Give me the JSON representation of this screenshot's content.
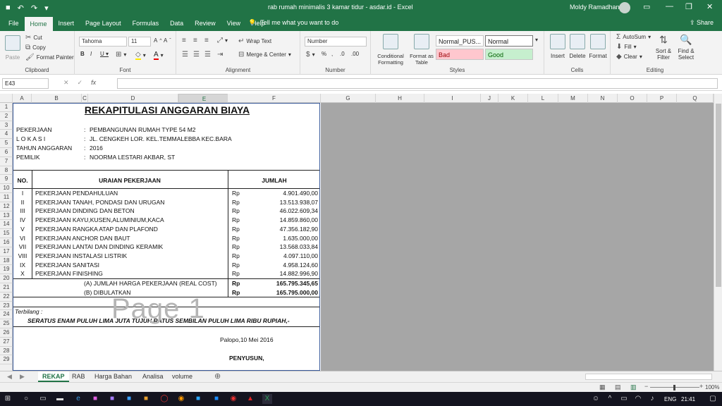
{
  "window": {
    "title": "rab rumah minimalis 3 kamar tidur - asdar.id  -  Excel",
    "user": "Moldy Ramadhan"
  },
  "tabs": [
    "File",
    "Home",
    "Insert",
    "Page Layout",
    "Formulas",
    "Data",
    "Review",
    "View",
    "Help"
  ],
  "active_tab": "Home",
  "tell_me": "Tell me what you want to do",
  "share": "Share",
  "ribbon": {
    "clipboard": {
      "paste": "Paste",
      "cut": "Cut",
      "copy": "Copy",
      "format_painter": "Format Painter",
      "label": "Clipboard"
    },
    "font": {
      "name": "Tahoma",
      "size": "11",
      "label": "Font"
    },
    "alignment": {
      "wrap": "Wrap Text",
      "merge": "Merge & Center",
      "label": "Alignment"
    },
    "number": {
      "format": "Number",
      "label": "Number"
    },
    "styles": {
      "cond": "Conditional Formatting",
      "table": "Format as Table",
      "s1": "Normal_PUS...",
      "s2": "Normal",
      "bad": "Bad",
      "good": "Good",
      "label": "Styles"
    },
    "cells": {
      "insert": "Insert",
      "delete": "Delete",
      "format": "Format",
      "label": "Cells"
    },
    "editing": {
      "autosum": "AutoSum",
      "fill": "Fill",
      "clear": "Clear",
      "sort": "Sort & Filter",
      "find": "Find & Select",
      "label": "Editing"
    }
  },
  "formula_bar": {
    "name_box": "E43",
    "formula": ""
  },
  "columns": [
    "A",
    "B",
    "C",
    "D",
    "E",
    "F",
    "G",
    "H",
    "I",
    "J",
    "K",
    "L",
    "M",
    "N",
    "O",
    "P",
    "Q"
  ],
  "sheet": {
    "title": "REKAPITULASI ANGGARAN BIAYA",
    "info": [
      {
        "label": "PEKERJAAN",
        "value": "PEMBANGUNAN RUMAH TYPE 54 M2"
      },
      {
        "label": "L O K A S I",
        "value": "JL. CENGKEH LOR. KEL.TEMMALEBBA KEC.BARA"
      },
      {
        "label": "TAHUN ANGGARAN",
        "value": "2016"
      },
      {
        "label": "PEMILIK",
        "value": "NOORMA LESTARI AKBAR, ST"
      }
    ],
    "header": {
      "no": "NO.",
      "uraian": "URAIAN PEKERJAAN",
      "jumlah": "JUMLAH"
    },
    "items": [
      {
        "no": "I",
        "desc": "PEKERJAAN PENDAHULUAN",
        "cur": "Rp",
        "amt": "4.901.490,00"
      },
      {
        "no": "II",
        "desc": "PEKERJAAN TANAH,  PONDASI DAN URUGAN",
        "cur": "Rp",
        "amt": "13.513.938,07"
      },
      {
        "no": "III",
        "desc": "PEKERJAAN DINDING DAN BETON",
        "cur": "Rp",
        "amt": "46.022.609,34"
      },
      {
        "no": "IV",
        "desc": "PEKERJAAN KAYU,KUSEN,ALUMINIUM,KACA",
        "cur": "Rp",
        "amt": "14.859.860,00"
      },
      {
        "no": "V",
        "desc": "PEKERJAAN RANGKA ATAP DAN PLAFOND",
        "cur": "Rp",
        "amt": "47.356.182,90"
      },
      {
        "no": "VI",
        "desc": "PEKERJAAN ANCHOR DAN BAUT",
        "cur": "Rp",
        "amt": "1.635.000,00"
      },
      {
        "no": "VII",
        "desc": "PEKERJAAN LANTAI DAN DINDING KERAMIK",
        "cur": "Rp",
        "amt": "13.568.033,84"
      },
      {
        "no": "VIII",
        "desc": "PEKERJAAN INSTALASI LISTRIK",
        "cur": "Rp",
        "amt": "4.097.110,00"
      },
      {
        "no": "IX",
        "desc": "PEKERJAAN SANITASI",
        "cur": "Rp",
        "amt": "4.958.124,60"
      },
      {
        "no": "X",
        "desc": "PEKERJAAN FINISHING",
        "cur": "Rp",
        "amt": "14.882.996,90"
      }
    ],
    "total_a": {
      "label": "(A) JUMLAH HARGA PEKERJAAN (REAL COST)",
      "cur": "Rp",
      "amt": "165.795.345,65"
    },
    "total_b": {
      "label": "(B) DIBULATKAN",
      "cur": "Rp",
      "amt": "165.795.000,00"
    },
    "terbilang_label": "Terbilang  :",
    "terbilang": "SERATUS ENAM PULUH LIMA JUTA TUJUH RATUS SEMBILAN PULUH LIMA RIBU RUPIAH,-",
    "place_date": "Palopo,10 Mei 2016",
    "signer": "PENYUSUN,",
    "watermark": "Page 1",
    "colon": ":"
  },
  "sheet_tabs": [
    "REKAP",
    "RAB",
    "Harga Bahan",
    "Analisa",
    "volume"
  ],
  "status": {
    "zoom": "100%"
  },
  "taskbar": {
    "lang": "ENG",
    "time": "21:41"
  },
  "colors": {
    "excel_green": "#217346",
    "page_border": "#3a5a9a"
  }
}
